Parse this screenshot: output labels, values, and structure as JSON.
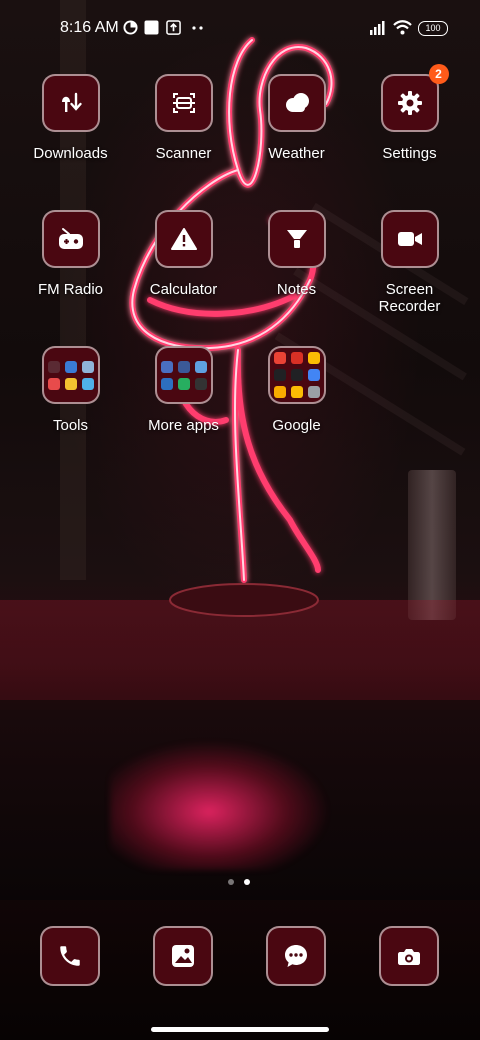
{
  "status_bar": {
    "time": "8:16 AM",
    "battery": "100",
    "left_icons": [
      "data-saver-icon",
      "notification-square-icon",
      "upload-icon",
      "more-dots-icon"
    ],
    "right_icons": [
      "signal-icon",
      "wifi-icon",
      "battery-icon"
    ]
  },
  "home": {
    "apps": [
      {
        "label": "Downloads",
        "icon": "downloads-icon"
      },
      {
        "label": "Scanner",
        "icon": "scanner-icon"
      },
      {
        "label": "Weather",
        "icon": "weather-icon"
      },
      {
        "label": "Settings",
        "icon": "settings-icon",
        "badge": "2"
      },
      {
        "label": "FM Radio",
        "icon": "radio-icon"
      },
      {
        "label": "Calculator",
        "icon": "warning-icon"
      },
      {
        "label": "Notes",
        "icon": "notes-icon"
      },
      {
        "label": "Screen\nRecorder",
        "icon": "video-camera-icon"
      },
      {
        "label": "Tools",
        "icon": "folder-icon"
      },
      {
        "label": "More apps",
        "icon": "folder-icon"
      },
      {
        "label": "Google",
        "icon": "folder-icon"
      }
    ]
  },
  "folders": {
    "tools": [
      "#5a2a33",
      "#3a7bd5",
      "#8fb4d9",
      "#e84b4b",
      "#f2c230",
      "#4fb0e8"
    ],
    "more_apps": [
      "#4a6fc1",
      "#3b5998",
      "#5fa0e0",
      "#2d6fbf",
      "#27ae60",
      "#333333"
    ],
    "google": [
      "#ea4335",
      "#d93025",
      "#fbbc04",
      "#202124",
      "#202124",
      "#4285f4",
      "#f9ab00",
      "#fbbc04",
      "#9aa0a6"
    ]
  },
  "page_indicator": {
    "total": 2,
    "active": 2
  },
  "dock": [
    {
      "name": "phone",
      "icon": "phone-icon"
    },
    {
      "name": "gallery",
      "icon": "gallery-icon"
    },
    {
      "name": "messages",
      "icon": "messages-icon"
    },
    {
      "name": "camera",
      "icon": "camera-icon"
    }
  ],
  "colors": {
    "tile_bg": "#4a0711",
    "badge": "#ff5b1a",
    "neon": "#ff3d6e"
  }
}
